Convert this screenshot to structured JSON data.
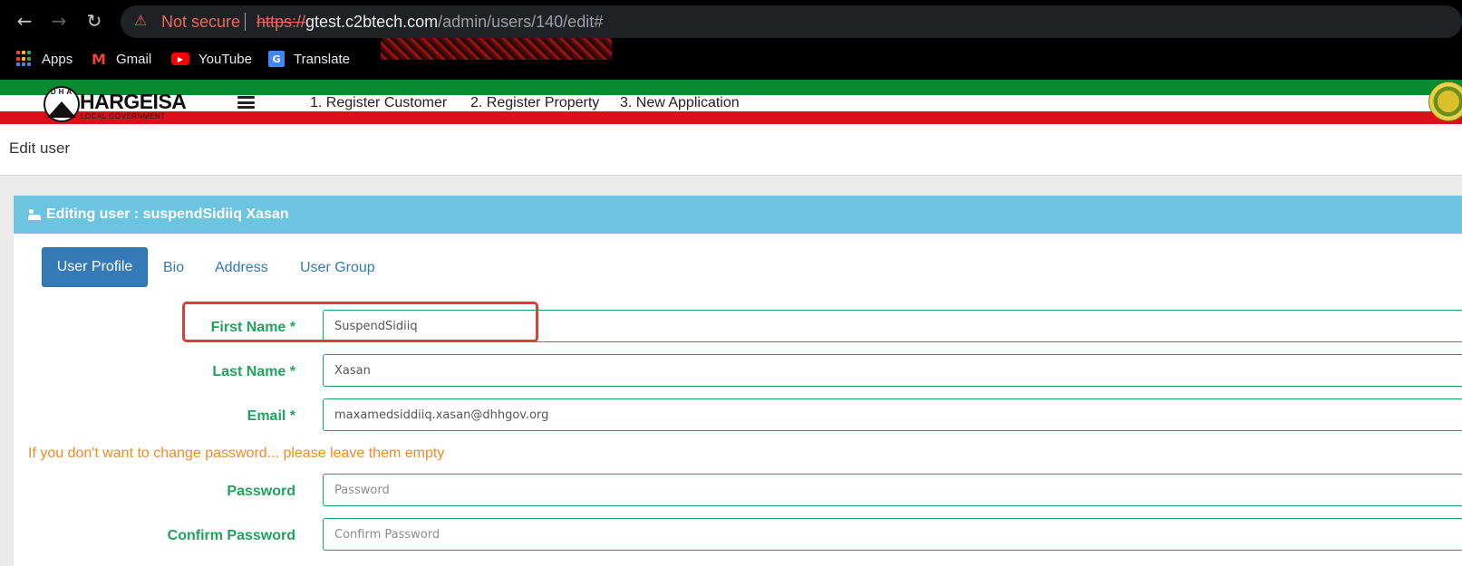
{
  "browser": {
    "security_label": "Not secure",
    "url_scheme": "https://",
    "url_host": "gtest.c2btech.com",
    "url_path": "/admin/users/140/edit#",
    "nav_icons": [
      "back-arrow-icon",
      "forward-arrow-icon",
      "reload-icon"
    ],
    "bookmarks": [
      {
        "label": "Apps",
        "icon": "apps-grid-icon"
      },
      {
        "label": "Gmail",
        "icon": "gmail-icon"
      },
      {
        "label": "YouTube",
        "icon": "youtube-icon"
      },
      {
        "label": "Translate",
        "icon": "translate-icon"
      }
    ]
  },
  "header": {
    "logo_letters": "DHA",
    "logo_text": "HARGEISA",
    "logo_subtext": "LOCAL GOVERNMENT",
    "nav": [
      "1. Register Customer",
      "2. Register Property",
      "3. New Application"
    ],
    "colors": {
      "green": "#0a8a30",
      "red": "#d9101a"
    }
  },
  "page": {
    "title": "Edit user"
  },
  "card": {
    "title": "Editing user : suspendSidiiq Xasan",
    "header_color": "#6cc4e0",
    "tabs": [
      {
        "label": "User Profile",
        "active": true
      },
      {
        "label": "Bio",
        "active": false
      },
      {
        "label": "Address",
        "active": false
      },
      {
        "label": "User Group",
        "active": false
      }
    ]
  },
  "form": {
    "first_name": {
      "label": "First Name *",
      "value": "SuspendSidiiq"
    },
    "last_name": {
      "label": "Last Name *",
      "value": "Xasan"
    },
    "email": {
      "label": "Email *",
      "value": "maxamedsiddiiq.xasan@dhhgov.org"
    },
    "password_hint": "If you don't want to change password... please leave them empty",
    "password": {
      "label": "Password",
      "placeholder": "Password",
      "value": ""
    },
    "confirm_password": {
      "label": "Confirm Password",
      "placeholder": "Confirm Password",
      "value": ""
    }
  }
}
